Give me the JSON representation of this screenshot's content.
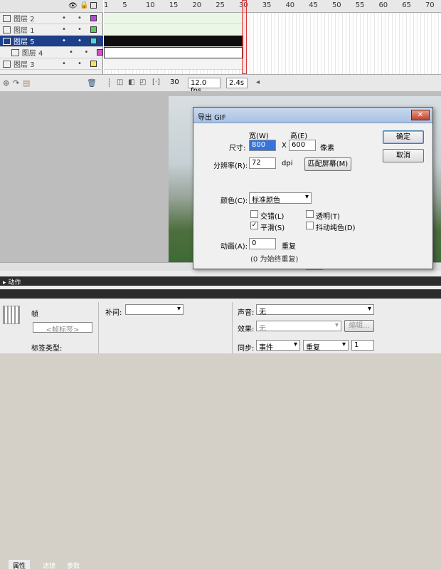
{
  "timeline": {
    "ruler_ticks": [
      "1",
      "5",
      "10",
      "15",
      "20",
      "25",
      "30",
      "35",
      "40",
      "45",
      "50",
      "55",
      "60",
      "65",
      "70"
    ],
    "layers": [
      {
        "name": "图层 2",
        "color": "#b24cd8",
        "selected": false,
        "indent": false
      },
      {
        "name": "图层 1",
        "color": "#5cc85c",
        "selected": false,
        "indent": false
      },
      {
        "name": "图层 5",
        "color": "#4ad8e6",
        "selected": true,
        "indent": false
      },
      {
        "name": "图层 4",
        "color": "#d84ccf",
        "selected": false,
        "indent": true
      },
      {
        "name": "图层 3",
        "color": "#f4e54a",
        "selected": false,
        "indent": false
      }
    ],
    "status": {
      "current_frame": "30",
      "fps": "12.0 fps",
      "time": "2.4s"
    }
  },
  "panels": {
    "actions_label": "动作",
    "tabs": [
      "属性",
      "滤镜",
      "参数"
    ],
    "frame_label": "帧",
    "frame_name_placeholder": "<帧标签>",
    "label_type": "标签类型:",
    "tween_label": "补间:",
    "sound_label": "声音:",
    "sound_value": "无",
    "effect_label": "效果:",
    "effect_value": "无",
    "edit_button": "编辑...",
    "sync_label": "同步:",
    "sync_value": "事件",
    "repeat_value": "重复",
    "repeat_count": "1"
  },
  "dialog": {
    "title": "导出 GIF",
    "width_label": "宽(W)",
    "height_label": "高(E)",
    "size_label": "尺寸:",
    "width_value": "800",
    "x_label": "X",
    "height_value": "600",
    "pixels_label": "像素",
    "resolution_label": "分辨率(R):",
    "resolution_value": "72",
    "dpi_label": "dpi",
    "match_screen_button": "匹配屏幕(M)",
    "color_label": "颜色(C):",
    "color_value": "标准颜色",
    "interlace_label": "交错(L)",
    "interlace_checked": false,
    "transparent_label": "透明(T)",
    "transparent_checked": false,
    "smooth_label": "平滑(S)",
    "smooth_checked": true,
    "dither_label": "抖动纯色(D)",
    "dither_checked": false,
    "animation_label": "动画(A):",
    "animation_value": "0",
    "repeat_label": "重复",
    "repeat_hint": "(0 为始终重复)",
    "ok_button": "确定",
    "cancel_button": "取消",
    "close_icon": "close-icon"
  }
}
